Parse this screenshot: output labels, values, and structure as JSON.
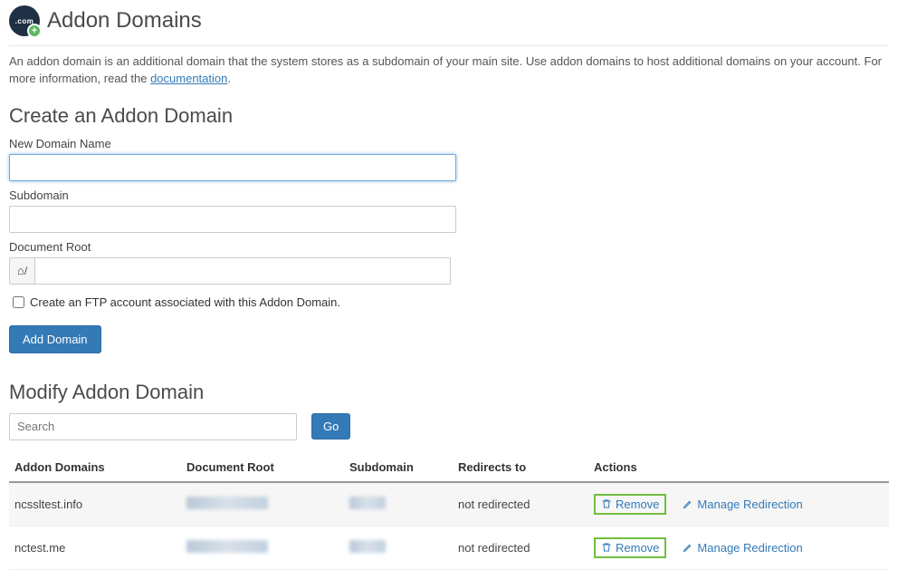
{
  "page": {
    "title": "Addon Domains",
    "icon_label": ".com"
  },
  "intro": {
    "text_before": "An addon domain is an additional domain that the system stores as a subdomain of your main site. Use addon domains to host additional domains on your account. For more information, read the ",
    "link_text": "documentation",
    "text_after": "."
  },
  "create": {
    "heading": "Create an Addon Domain",
    "new_domain_label": "New Domain Name",
    "new_domain_value": "",
    "subdomain_label": "Subdomain",
    "subdomain_value": "",
    "docroot_label": "Document Root",
    "docroot_prefix": "/",
    "docroot_value": "",
    "ftp_checkbox_label": "Create an FTP account associated with this Addon Domain.",
    "ftp_checked": false,
    "submit_label": "Add Domain"
  },
  "modify": {
    "heading": "Modify Addon Domain",
    "search_placeholder": "Search",
    "go_label": "Go",
    "columns": {
      "addon": "Addon Domains",
      "docroot": "Document Root",
      "subdomain": "Subdomain",
      "redirects": "Redirects to",
      "actions": "Actions"
    },
    "rows": [
      {
        "domain": "ncssltest.info",
        "redirects": "not redirected",
        "remove": "Remove",
        "manage": "Manage Redirection"
      },
      {
        "domain": "nctest.me",
        "redirects": "not redirected",
        "remove": "Remove",
        "manage": "Manage Redirection"
      }
    ]
  }
}
